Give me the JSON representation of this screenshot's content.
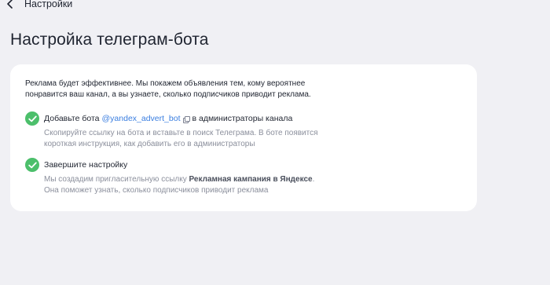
{
  "nav": {
    "back_label": "Настройки",
    "back_icon": "chevron-left-icon"
  },
  "page": {
    "title": "Настройка телеграм-бота"
  },
  "card": {
    "intro": "Реклама будет эффективнее. Мы покажем объявления тем, кому вероятнее понравится ваш канал, а вы узнаете, сколько подписчиков приводит реклама.",
    "steps": [
      {
        "status": "done",
        "icon": "check-icon",
        "title_prefix": "Добавьте бота",
        "bot_username": "@yandex_advert_bot",
        "copy_icon": "copy-icon",
        "title_suffix": "в администраторы канала",
        "description": "Скопируйте ссылку на бота и вставьте в поиск Телеграма. В боте появится короткая инструкция, как добавить его в администраторы"
      },
      {
        "status": "done",
        "icon": "check-icon",
        "title": "Завершите настройку",
        "desc_prefix": "Мы создадим пригласительную ссылку",
        "desc_bold": "Рекламная кампания в Яндексе",
        "desc_suffix": ". Она поможет узнать, сколько подписчиков приводит реклама"
      }
    ]
  },
  "colors": {
    "background": "#f0f0f4",
    "card": "#ffffff",
    "success": "#4cbf6b",
    "link": "#3a7ee0",
    "text_primary": "#1f2430",
    "text_secondary": "#8b8f9c"
  }
}
